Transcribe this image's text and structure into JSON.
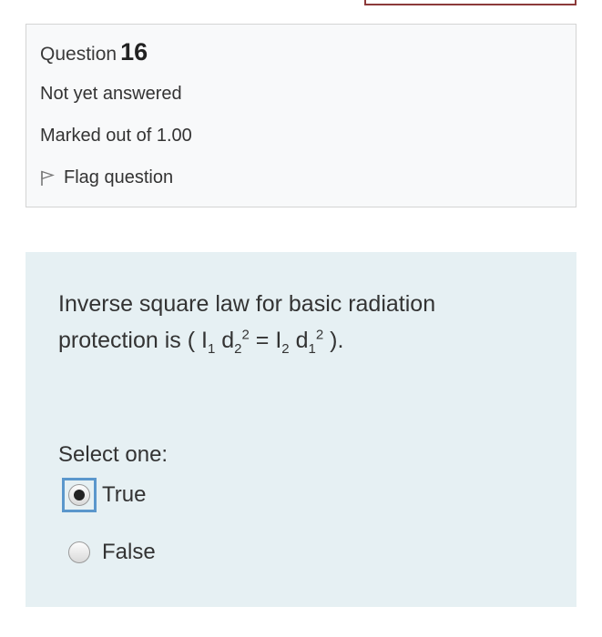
{
  "question": {
    "label": "Question",
    "number": "16",
    "state": "Not yet answered",
    "grade": "Marked out of 1.00",
    "flag_label": "Flag question"
  },
  "content": {
    "text_intro": "Inverse square law for basic radiation protection is ( I",
    "sub1": "1",
    "d_a": " d",
    "sub2": "2",
    "sup_a": "2",
    "equals": " = I",
    "sub3": "2",
    "d_b": " d",
    "sub4": "1",
    "sup_b": "2",
    "text_end": " ).",
    "prompt": "Select one:",
    "options": [
      {
        "label": "True",
        "selected": true
      },
      {
        "label": "False",
        "selected": false
      }
    ]
  }
}
